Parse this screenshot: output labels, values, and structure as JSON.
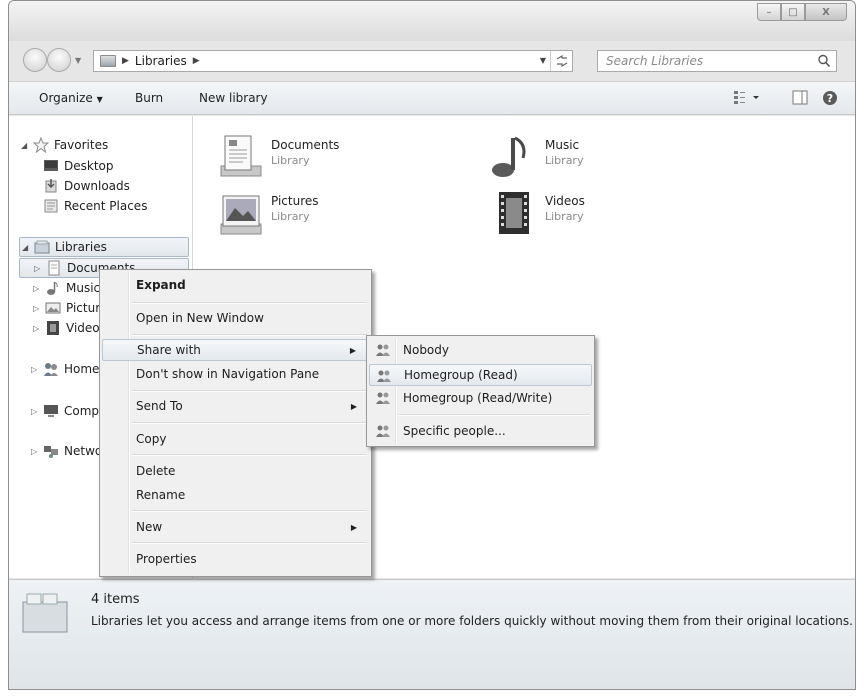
{
  "window": {
    "caption_buttons": [
      "minimize-icon",
      "maximize-icon",
      "close-icon"
    ],
    "minimize_glyph": "–",
    "maximize_glyph": "□",
    "close_glyph": "X"
  },
  "address": {
    "path": [
      "Libraries"
    ],
    "search_placeholder": "Search Libraries"
  },
  "toolbar": {
    "organize": "Organize",
    "burn": "Burn",
    "new_library": "New library"
  },
  "nav": {
    "favorites": "Favorites",
    "desktop": "Desktop",
    "downloads": "Downloads",
    "recent": "Recent Places",
    "libraries": "Libraries",
    "documents": "Documents",
    "music": "Music",
    "pictures": "Pictures",
    "videos": "Videos",
    "homegroup": "Homegroup",
    "computer": "Computer",
    "network": "Network"
  },
  "libraries": [
    {
      "name": "Documents",
      "type": "Library",
      "icon": "documents-library-icon"
    },
    {
      "name": "Music",
      "type": "Library",
      "icon": "music-library-icon"
    },
    {
      "name": "Pictures",
      "type": "Library",
      "icon": "pictures-library-icon"
    },
    {
      "name": "Videos",
      "type": "Library",
      "icon": "videos-library-icon"
    }
  ],
  "context_menu": {
    "expand": "Expand",
    "open_new_window": "Open in New Window",
    "share_with": "Share with",
    "dont_show": "Don't show in Navigation Pane",
    "send_to": "Send To",
    "copy": "Copy",
    "delete": "Delete",
    "rename": "Rename",
    "new": "New",
    "properties": "Properties"
  },
  "share_submenu": {
    "nobody": "Nobody",
    "homegroup_read": "Homegroup (Read)",
    "homegroup_readwrite": "Homegroup (Read/Write)",
    "specific": "Specific people..."
  },
  "status": {
    "count": "4 items",
    "description": "Libraries let you access and arrange items from one or more folders quickly without moving them from their original locations."
  }
}
